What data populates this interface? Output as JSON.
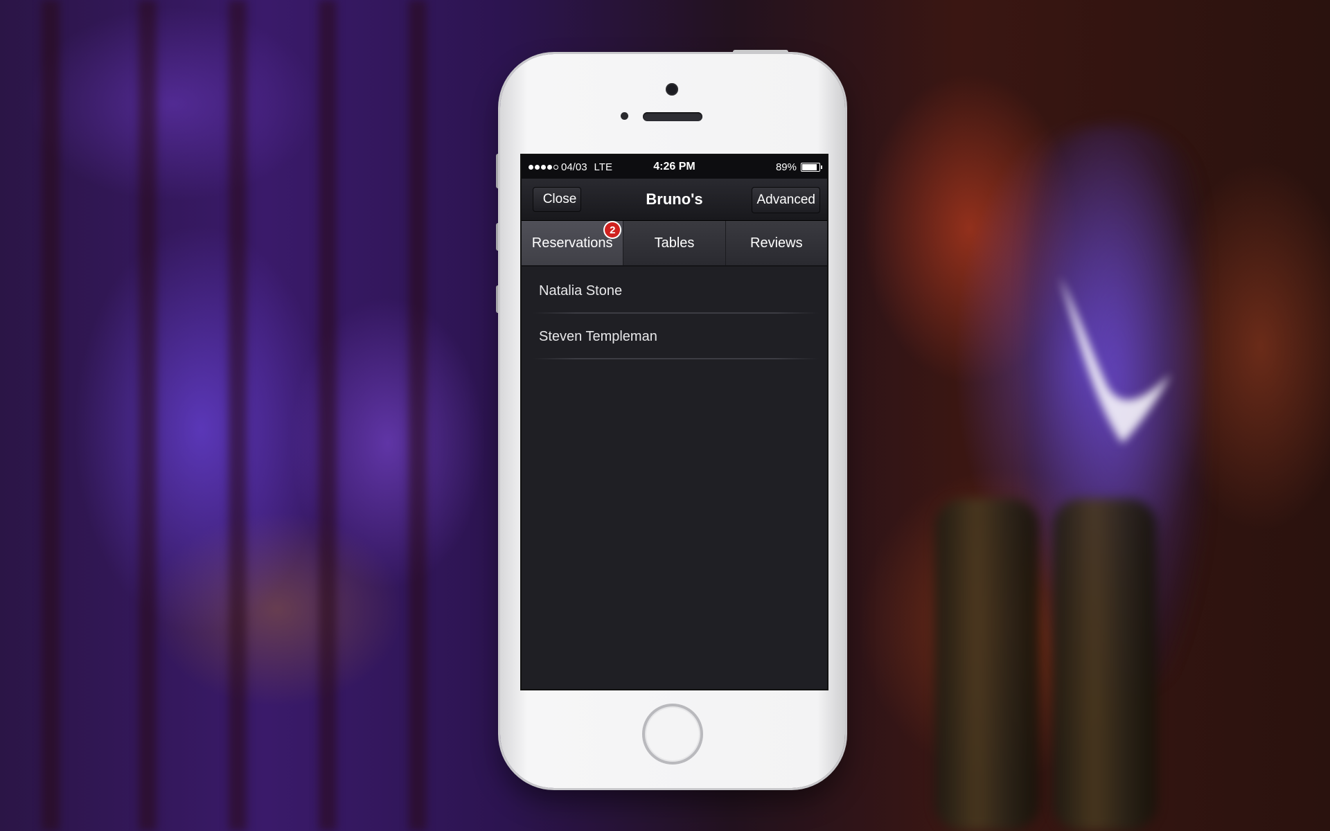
{
  "status": {
    "carrier": "04/03",
    "network": "LTE",
    "time": "4:26 PM",
    "battery": "89%",
    "battery_level": 0.89,
    "signal_bars": 4
  },
  "navbar": {
    "close_label": "Close",
    "title": "Bruno's",
    "advanced_label": "Advanced"
  },
  "tabs": [
    {
      "label": "Reservations",
      "badge": "2",
      "active": true
    },
    {
      "label": "Tables"
    },
    {
      "label": "Reviews"
    }
  ],
  "reservations": [
    {
      "name": "Natalia Stone"
    },
    {
      "name": "Steven Templeman"
    }
  ],
  "colors": {
    "badge": "#d0211f",
    "screen_bg": "#1f1f24",
    "phone_body": "#f3f3f4"
  }
}
